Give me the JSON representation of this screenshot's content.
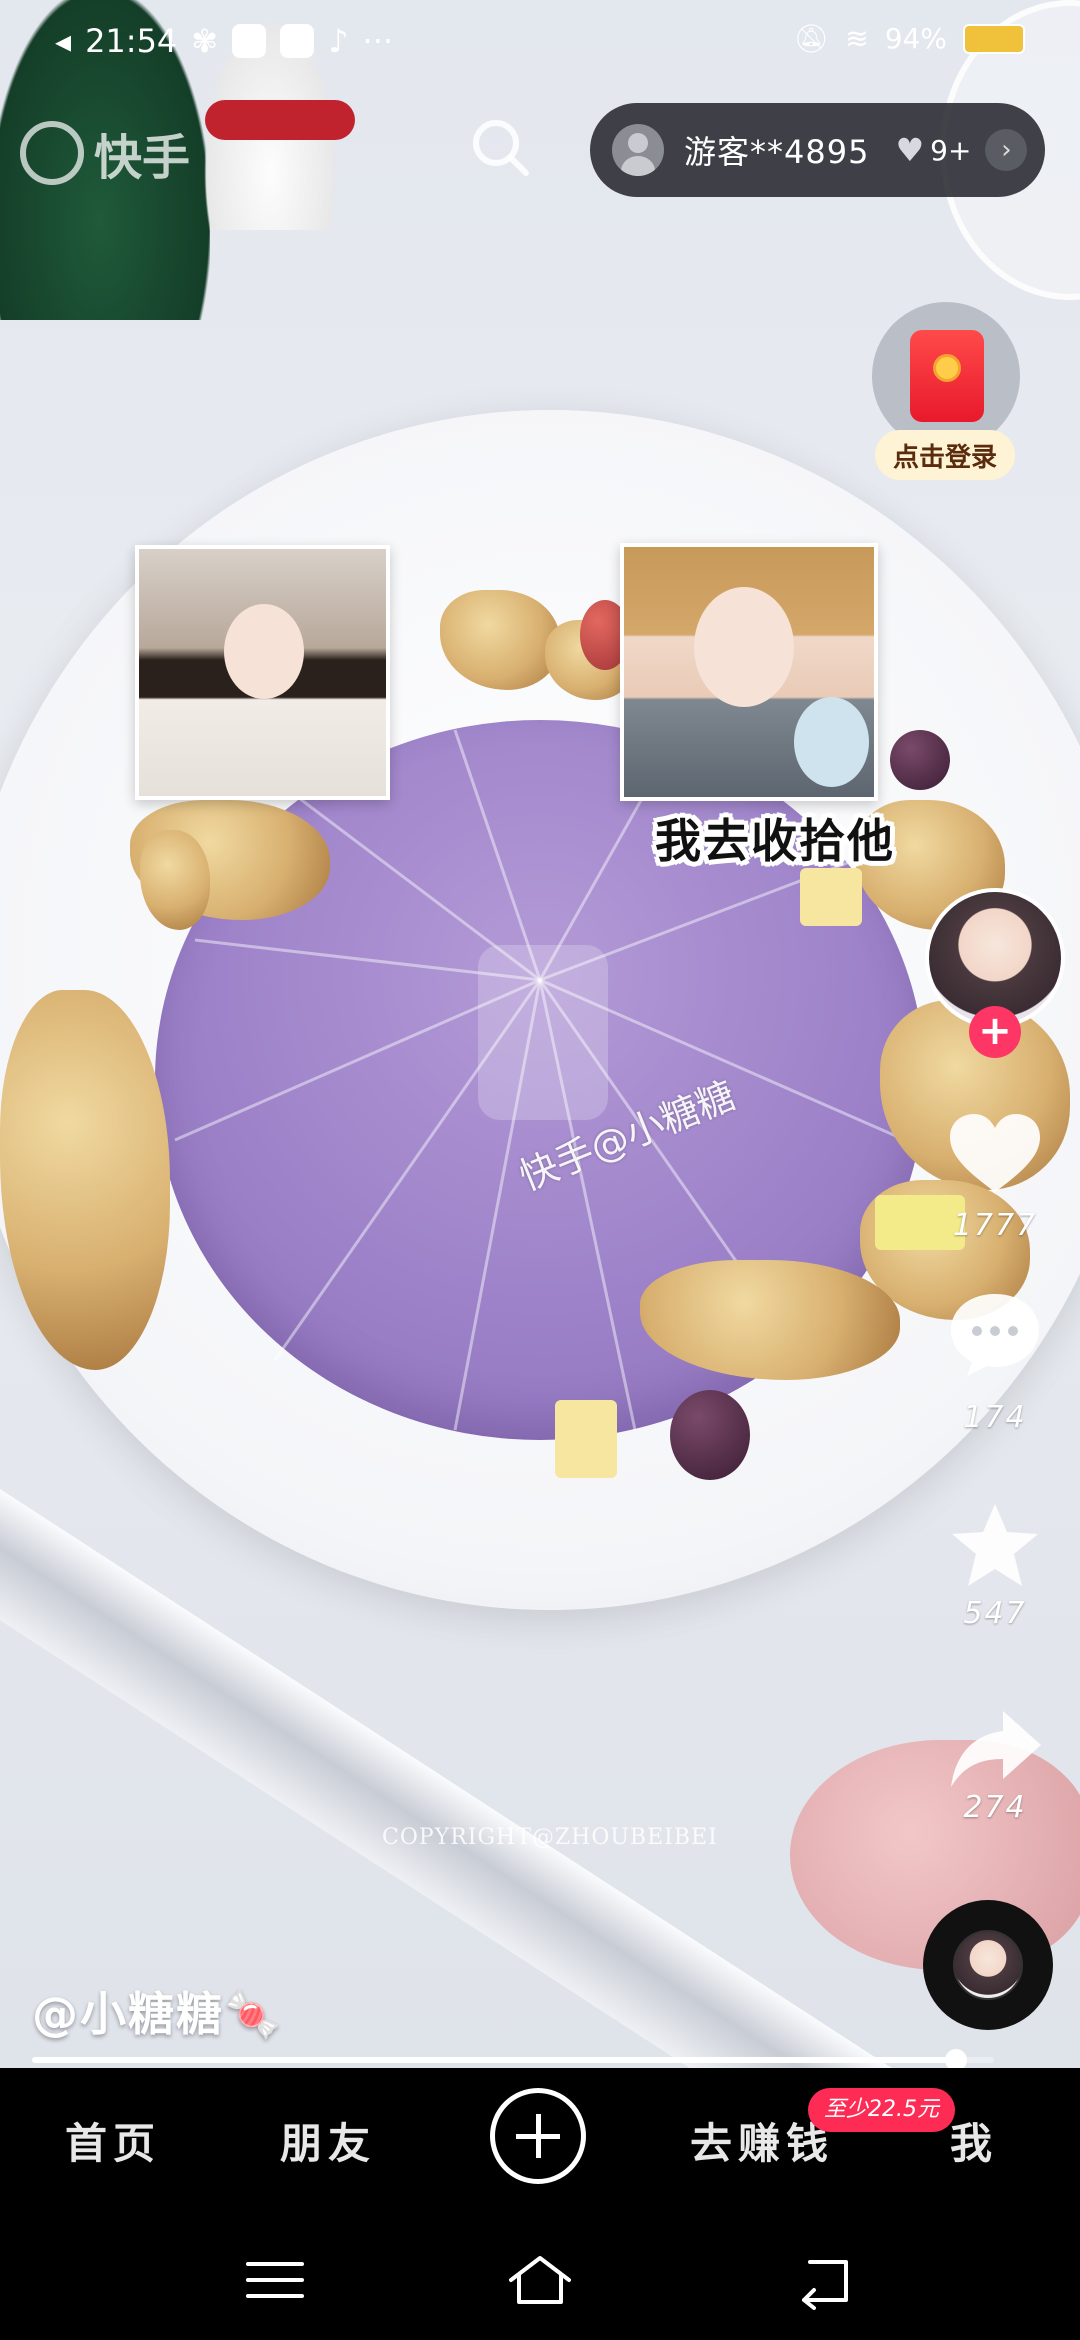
{
  "status_bar": {
    "time": "21:54",
    "battery": "94%"
  },
  "top_bar": {
    "app_name": "快手",
    "guest": {
      "name": "游客**4895",
      "notification_count": "9+"
    },
    "login_badge": "点击登录"
  },
  "video": {
    "sticker_text": "我去收拾他",
    "watermark": "快手@小糖糖",
    "copyright": "COPYRIGHT@ZHOUBEIBEI",
    "caption": "@小糖糖🍬",
    "progress": 0.96
  },
  "actions": {
    "likes": "1777",
    "comments": "174",
    "favorites": "547",
    "shares": "274"
  },
  "bottom_nav": {
    "home": "首页",
    "friends": "朋友",
    "earn": "去赚钱",
    "earn_badge": "至少22.5元",
    "me": "我"
  },
  "icons": {
    "status": [
      "pinwheel-icon",
      "mail-icon",
      "snowman-icon",
      "tiktok-icon",
      "more-dots-icon",
      "mute-icon",
      "wifi-icon",
      "battery-icon"
    ],
    "top": [
      "kuaishou-logo-icon",
      "search-icon",
      "guest-avatar-icon",
      "heart-icon",
      "chevron-right-icon",
      "red-packet-icon"
    ],
    "rail": [
      "author-avatar",
      "follow-plus-icon",
      "heart-icon",
      "comment-icon",
      "star-icon",
      "share-icon",
      "music-disc-icon"
    ],
    "system": [
      "menu-icon",
      "home-icon",
      "back-icon"
    ]
  },
  "colors": {
    "accent": "#fe3666",
    "earn_badge": "#fe2c55",
    "login_badge_bg": "#fff3d6",
    "cake": "#9d82c9"
  }
}
